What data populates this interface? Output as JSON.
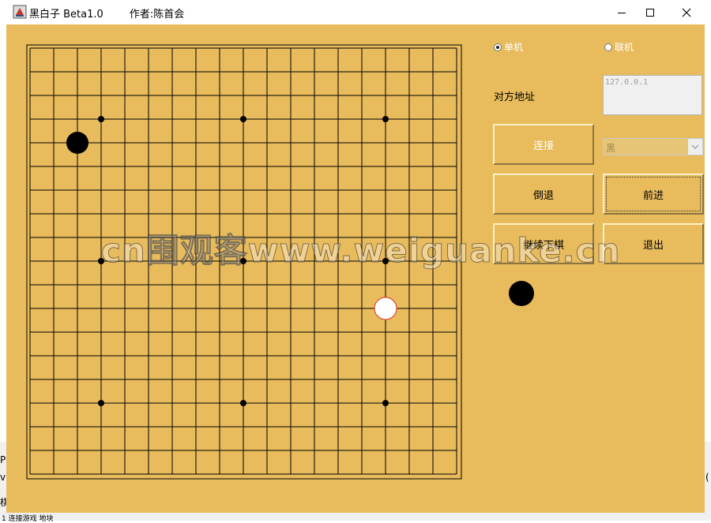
{
  "window": {
    "title": "黑白子 Beta1.0",
    "author": "作者:陈首会"
  },
  "mode": {
    "single_label": "单机",
    "single_checked": true,
    "online_label": "联机",
    "online_checked": false
  },
  "address": {
    "label": "对方地址",
    "value": "127.0.0.1"
  },
  "buttons": {
    "connect": "连接",
    "undo": "倒退",
    "forward": "前进",
    "continue": "继续下棋",
    "exit": "退出"
  },
  "color_select": {
    "value": "黑"
  },
  "board": {
    "size": 19,
    "star_points": [
      [
        3,
        3
      ],
      [
        9,
        3
      ],
      [
        15,
        3
      ],
      [
        3,
        9
      ],
      [
        9,
        9
      ],
      [
        15,
        9
      ],
      [
        3,
        15
      ],
      [
        9,
        15
      ],
      [
        15,
        15
      ]
    ],
    "stones": [
      {
        "col": 2,
        "row": 4,
        "color": "black"
      },
      {
        "col": 15,
        "row": 11,
        "color": "white",
        "last_move": true
      }
    ]
  },
  "turn": {
    "color": "black"
  },
  "background_text": {
    "line1": "P",
    "line2": "v",
    "line3": "棋",
    "line4": "1 连接游戏  地块",
    "right": "("
  },
  "watermark": "cn围观客www.weiguanke.cn",
  "colors": {
    "board_bg": "#e8bb5d",
    "last_move_ring": "#e03020"
  }
}
